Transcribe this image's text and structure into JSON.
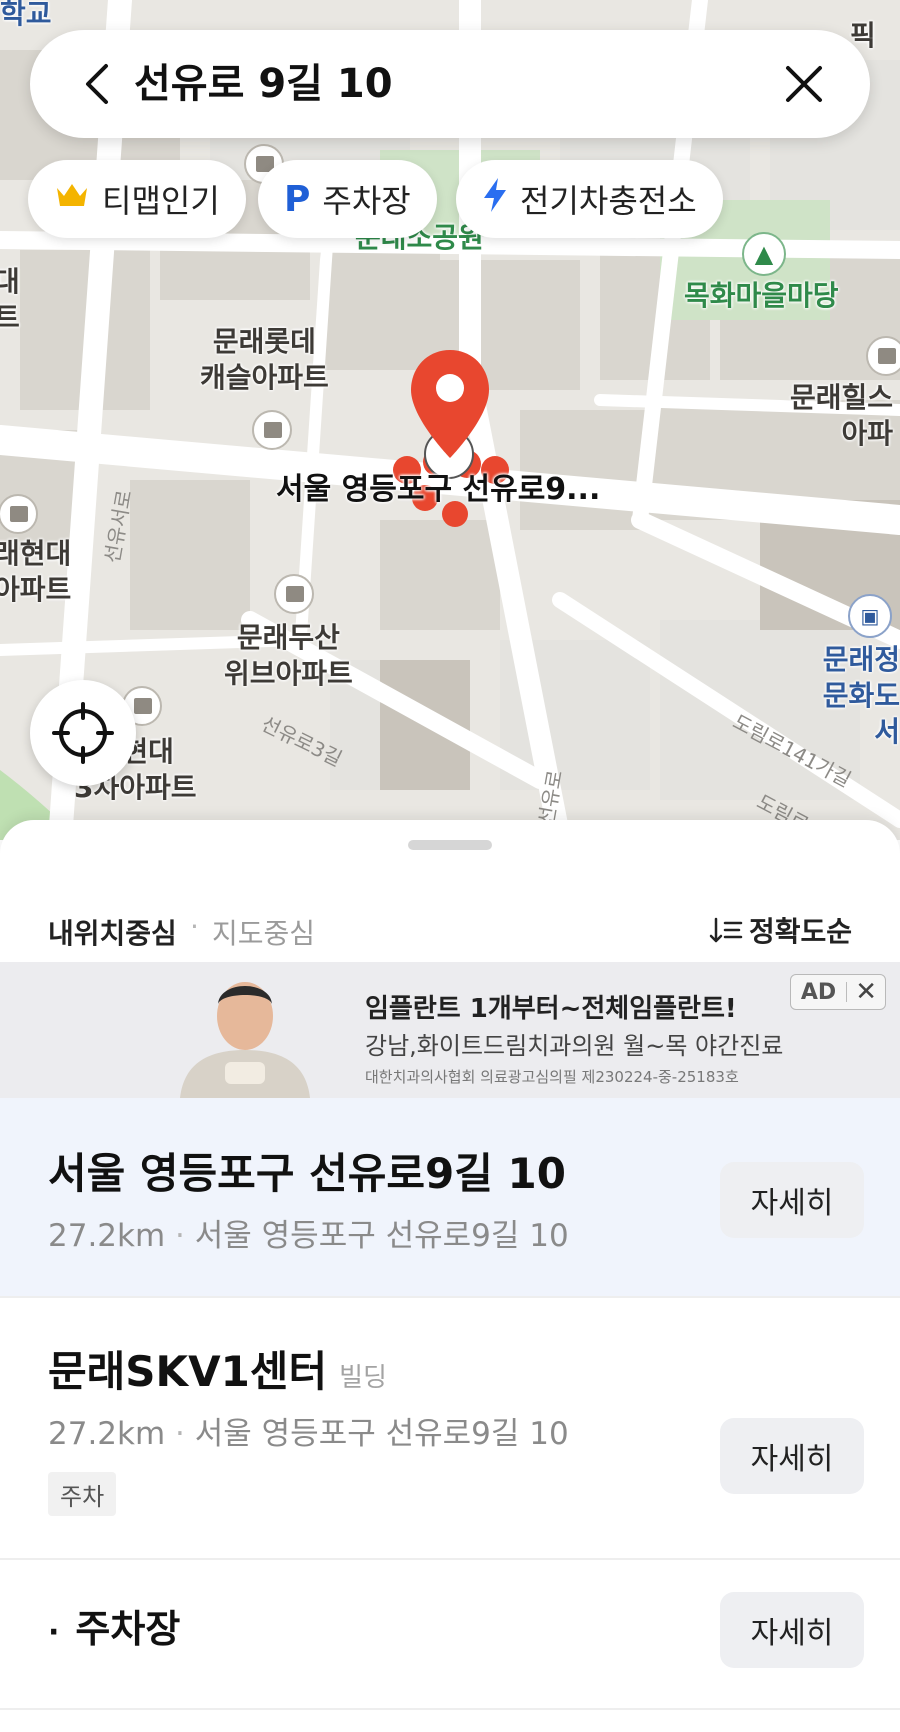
{
  "search": {
    "title": "선유로 9길 10",
    "back_icon": "chevron-left-icon",
    "clear_icon": "close-icon"
  },
  "chips": [
    {
      "label": "티맵인기",
      "icon": "crown-icon",
      "color": "#f4b400"
    },
    {
      "label": "주차장",
      "icon": "parking-icon",
      "color": "#1f5fd6"
    },
    {
      "label": "전기차충전소",
      "icon": "lightning-icon",
      "color": "#2a6ef0"
    }
  ],
  "map": {
    "labels": {
      "school": "학교",
      "park": "문래소공원",
      "mokhwa": "목화마을마당",
      "lotte": "문래롯데\n캐슬아파트",
      "hills": "문래힐스\n아파",
      "hyundai_left": "래현대\n아파트",
      "doosan": "문래두산\n위브아파트",
      "hyundai3": "래현대\n3차아파트",
      "library": "문래정\n문화도서",
      "left_edge": "대\n트",
      "top_right": "픽",
      "pin_label": "서울 영등포구 선유로9..."
    },
    "road_labels": {
      "seonyuseo": "선유서로",
      "seonyu3": "선유로3길",
      "seonyuro": "선유로",
      "dorim141": "도림로141가길",
      "dorim": "도림로"
    },
    "pin_color": "#e8472f"
  },
  "sheet": {
    "mode_mine": "내위치중심",
    "mode_sep": "·",
    "mode_map": "지도중심",
    "sort_label": "정확도순",
    "sort_icon": "sort-icon"
  },
  "ad": {
    "badge": "AD",
    "title": "임플란트 1개부터~전체임플란트!",
    "subtitle": "강남,화이트드림치과의원 월~목 야간진료",
    "fine_print": "대한치과의사협회 의료광고심의필 제230224-중-25183호"
  },
  "results": [
    {
      "title": "서울 영등포구 선유로9길 10",
      "category": "",
      "distance": "27.2km",
      "address": "서울 영등포구 선유로9길 10",
      "button": "자세히",
      "highlight": true
    },
    {
      "title": "문래SKV1센터",
      "category": "빌딩",
      "distance": "27.2km",
      "address": "서울 영등포구 선유로9길 10",
      "tag": "주차",
      "button": "자세히"
    },
    {
      "title": "주차장",
      "bullet": "·",
      "button": "자세히"
    }
  ]
}
